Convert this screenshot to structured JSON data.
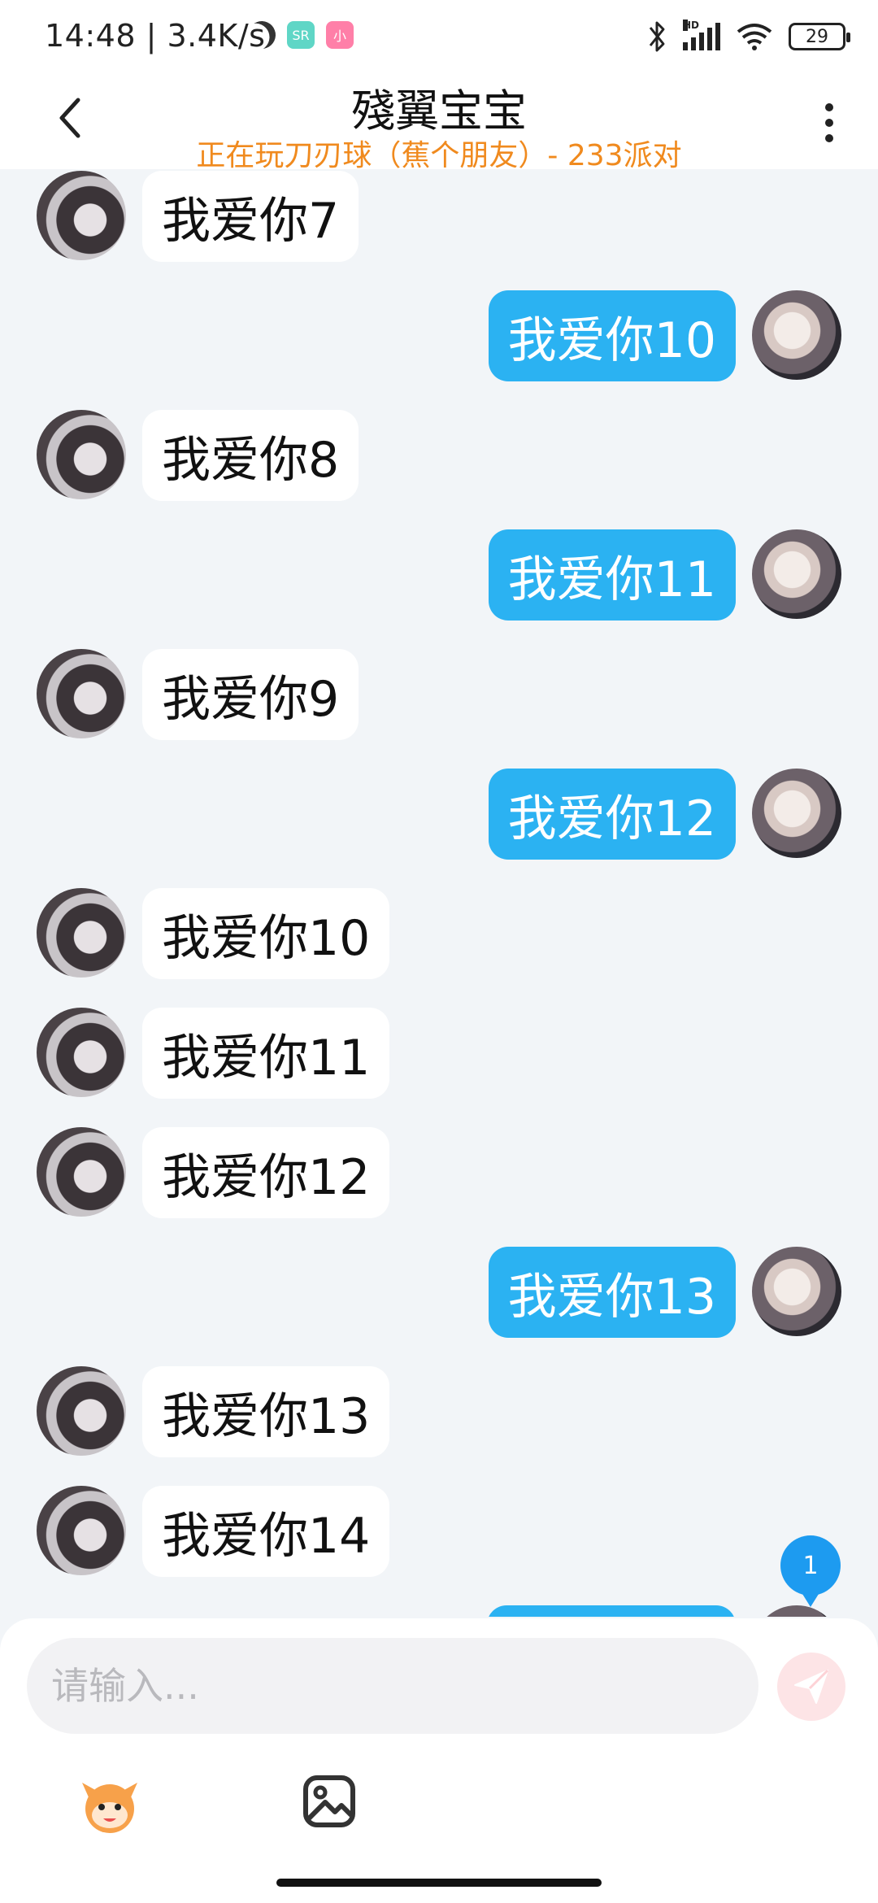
{
  "status_bar": {
    "time": "14:48 | 3.4K/s",
    "app_badges": [
      "SR",
      "小"
    ],
    "network_type": "HD",
    "battery": "29",
    "icons": [
      "moon-icon",
      "bluetooth-icon",
      "signal-icon",
      "wifi-icon",
      "battery-icon"
    ]
  },
  "header": {
    "title": "殘翼宝宝",
    "subtitle": "正在玩刀刃球（蕉个朋友）- 233派对",
    "back_icon": "chevron-left-icon",
    "more_icon": "more-vertical-icon"
  },
  "messages": [
    {
      "side": "in",
      "text": "我爱你7"
    },
    {
      "side": "out",
      "text": "我爱你10"
    },
    {
      "side": "in",
      "text": "我爱你8"
    },
    {
      "side": "out",
      "text": "我爱你11"
    },
    {
      "side": "in",
      "text": "我爱你9"
    },
    {
      "side": "out",
      "text": "我爱你12"
    },
    {
      "side": "in",
      "text": "我爱你10"
    },
    {
      "side": "in",
      "text": "我爱你11"
    },
    {
      "side": "in",
      "text": "我爱你12"
    },
    {
      "side": "out",
      "text": "我爱你13"
    },
    {
      "side": "in",
      "text": "我爱你13"
    },
    {
      "side": "in",
      "text": "我爱你14"
    },
    {
      "side": "out",
      "text": ""
    }
  ],
  "unread_count": "1",
  "composer": {
    "placeholder": "请输入...",
    "value": "",
    "send_icon": "send-icon",
    "tools": [
      "emoji-mascot-icon",
      "image-icon"
    ]
  },
  "colors": {
    "outgoing_bubble": "#2bb2f2",
    "incoming_bubble": "#ffffff",
    "subtitle": "#f08a1e",
    "chat_background": "#f2f5f8",
    "unread_badge": "#1d9bf0"
  }
}
